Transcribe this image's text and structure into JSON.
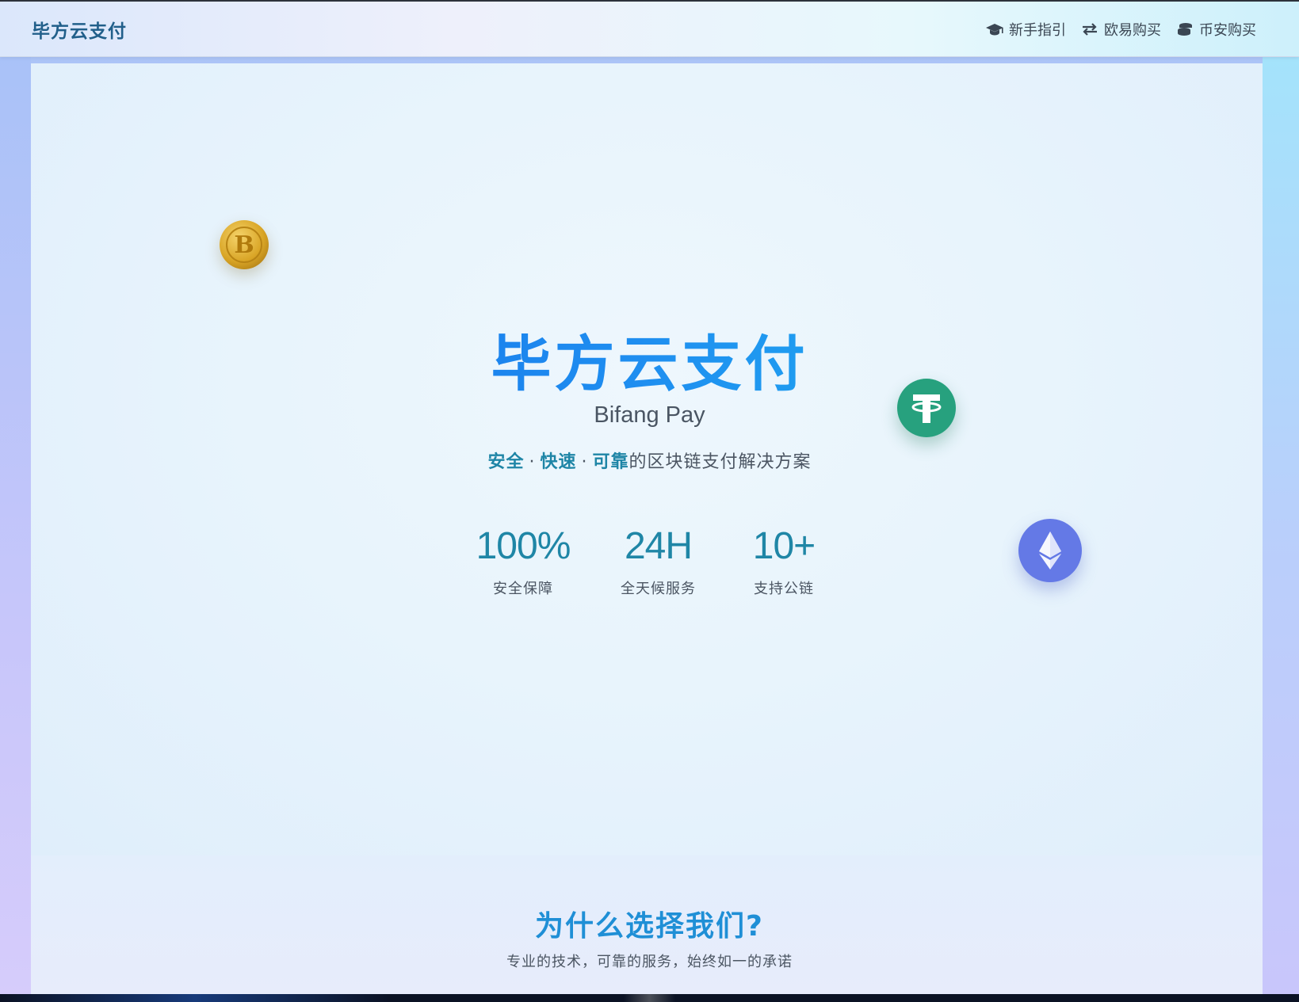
{
  "nav": {
    "brand": "毕方云支付",
    "links": [
      {
        "label": "新手指引",
        "icon": "graduation-cap-icon"
      },
      {
        "label": "欧易购买",
        "icon": "exchange-arrows-icon"
      },
      {
        "label": "币安购买",
        "icon": "coins-stack-icon"
      }
    ]
  },
  "hero": {
    "title": "毕方云支付",
    "subtitle": "Bifang Pay",
    "tagline": {
      "highlights": [
        "安全",
        "快速",
        "可靠"
      ],
      "separator": "·",
      "rest": "的区块链支付解决方案"
    },
    "stats": [
      {
        "value": "100%",
        "label": "安全保障"
      },
      {
        "value": "24H",
        "label": "全天候服务"
      },
      {
        "value": "10+",
        "label": "支持公链"
      }
    ],
    "coins": [
      {
        "name": "bitcoin-icon",
        "symbol": "B",
        "color": "#d9a526"
      },
      {
        "name": "tether-icon",
        "symbol": "T",
        "color": "#27a17e"
      },
      {
        "name": "ethereum-icon",
        "symbol": "",
        "color": "#6479e6"
      }
    ]
  },
  "why": {
    "title": "为什么选择我们?",
    "subtitle": "专业的技术，可靠的服务，始终如一的承诺"
  },
  "colors": {
    "accent": "#1f86a6",
    "title_gradient_start": "#1264e8",
    "title_gradient_end": "#20c4f2"
  }
}
